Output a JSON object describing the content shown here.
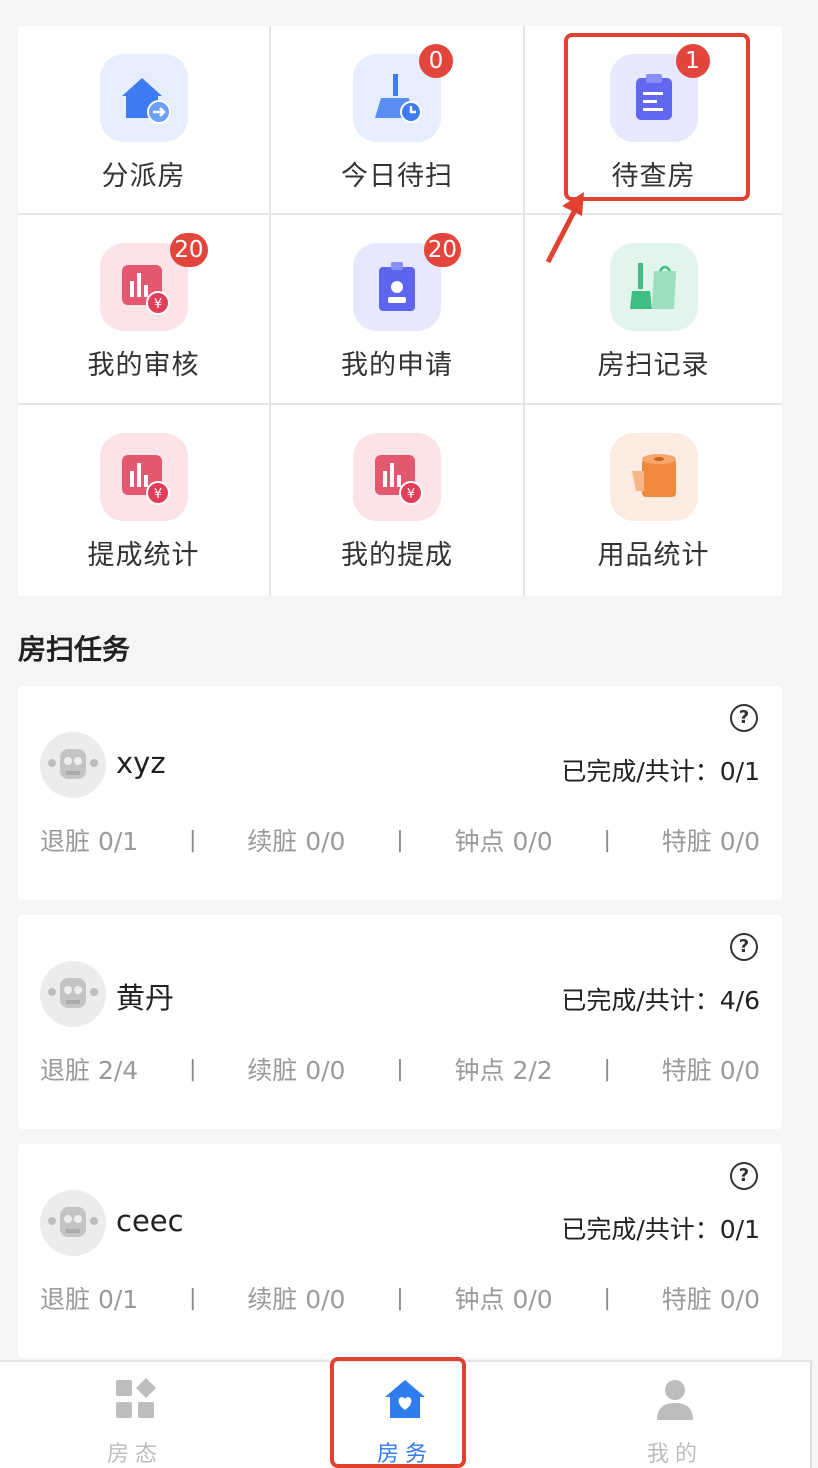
{
  "menu": [
    {
      "label": "分派房",
      "icon": "house-assign-icon",
      "badge": ""
    },
    {
      "label": "今日待扫",
      "icon": "broom-clock-icon",
      "badge": "0"
    },
    {
      "label": "待查房",
      "icon": "clipboard-icon",
      "badge": "1"
    },
    {
      "label": "我的审核",
      "icon": "chart-yen-icon",
      "badge": "20"
    },
    {
      "label": "我的申请",
      "icon": "id-badge-icon",
      "badge": "20"
    },
    {
      "label": "房扫记录",
      "icon": "broom-bag-icon",
      "badge": ""
    },
    {
      "label": "提成统计",
      "icon": "chart-yen-icon",
      "badge": ""
    },
    {
      "label": "我的提成",
      "icon": "chart-yen-icon",
      "badge": ""
    },
    {
      "label": "用品统计",
      "icon": "tissue-roll-icon",
      "badge": ""
    }
  ],
  "section_title": "房扫任务",
  "tasks": [
    {
      "name": "xyz",
      "progress": "已完成/共计：0/1",
      "stats": [
        "退脏 0/1",
        "续脏 0/0",
        "钟点 0/0",
        "特脏 0/0"
      ]
    },
    {
      "name": "黄丹",
      "progress": "已完成/共计：4/6",
      "stats": [
        "退脏 2/4",
        "续脏 0/0",
        "钟点 2/2",
        "特脏 0/0"
      ]
    },
    {
      "name": "ceec",
      "progress": "已完成/共计：0/1",
      "stats": [
        "退脏 0/1",
        "续脏 0/0",
        "钟点 0/0",
        "特脏 0/0"
      ]
    }
  ],
  "help_glyph": "?",
  "stat_separator": "|",
  "tabs": [
    {
      "label": "房态",
      "icon": "room-status-icon",
      "active": false
    },
    {
      "label": "房务",
      "icon": "house-heart-icon",
      "active": true
    },
    {
      "label": "我的",
      "icon": "user-icon",
      "active": false
    }
  ],
  "colors": {
    "badge": "#e2453c",
    "active_tab": "#2f7bf0",
    "highlight": "#e0422f"
  }
}
